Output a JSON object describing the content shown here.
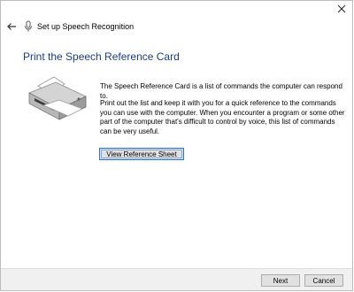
{
  "window": {
    "title": "Set up Speech Recognition",
    "icons": {
      "back": "back-arrow-icon",
      "title": "microphone-icon",
      "close": "close-icon"
    }
  },
  "page": {
    "heading": "Print the Speech Reference Card",
    "illustration": "printer-icon",
    "paragraph1": "The Speech Reference Card is a list of commands the computer can respond to.",
    "paragraph2": "Print out the list and keep it with you for a quick reference to the commands you can use with the computer. When you encounter a program or some other part of the computer that's difficult to control by voice, this list of commands can be very useful.",
    "view_button": "View Reference Sheet"
  },
  "footer": {
    "next": "Next",
    "cancel": "Cancel"
  },
  "colors": {
    "heading": "#1c3b8a",
    "focus_border": "#2f6fd0",
    "button_face": "#e1e1e1",
    "footer_bg": "#f0f0f0"
  }
}
